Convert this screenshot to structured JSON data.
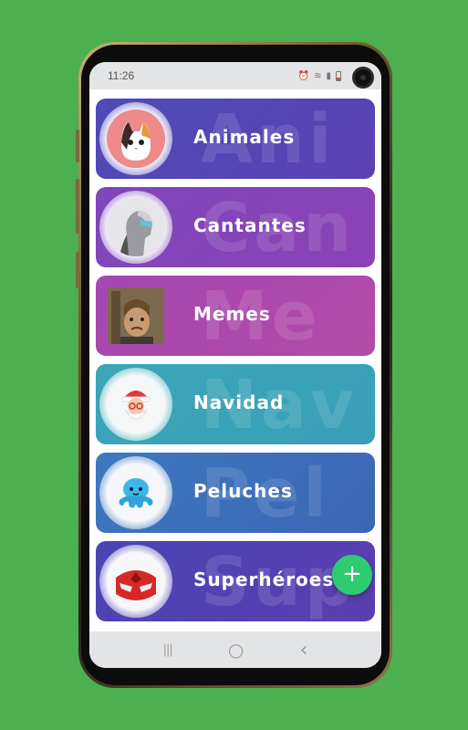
{
  "status_bar": {
    "time": "11:26",
    "icons": [
      "alarm-icon",
      "wifi-icon",
      "signal-icon",
      "battery-icon"
    ]
  },
  "categories": [
    {
      "label": "Animales",
      "watermark": "Ani",
      "colors": [
        "#4e4ab8",
        "#5b41b3"
      ],
      "icon": "cat-icon"
    },
    {
      "label": "Cantantes",
      "watermark": "Can",
      "colors": [
        "#7d47bb",
        "#8c42b6"
      ],
      "icon": "singer-icon"
    },
    {
      "label": "Memes",
      "watermark": "Me",
      "colors": [
        "#a547b2",
        "#b34aa7"
      ],
      "icon": "meme-face-icon"
    },
    {
      "label": "Navidad",
      "watermark": "Nav",
      "colors": [
        "#3aa6b7",
        "#3a9fb9"
      ],
      "icon": "santa-icon"
    },
    {
      "label": "Peluches",
      "watermark": "Pel",
      "colors": [
        "#3e78bf",
        "#3b66b6"
      ],
      "icon": "octopus-plush-icon"
    },
    {
      "label": "Superhéroes",
      "watermark": "Sup",
      "colors": [
        "#4a44b4",
        "#5b3eb0"
      ],
      "icon": "mask-icon"
    }
  ],
  "fab": {
    "label": "+"
  },
  "navbar": {
    "recent": "|||",
    "home": "○",
    "back": "‹"
  }
}
